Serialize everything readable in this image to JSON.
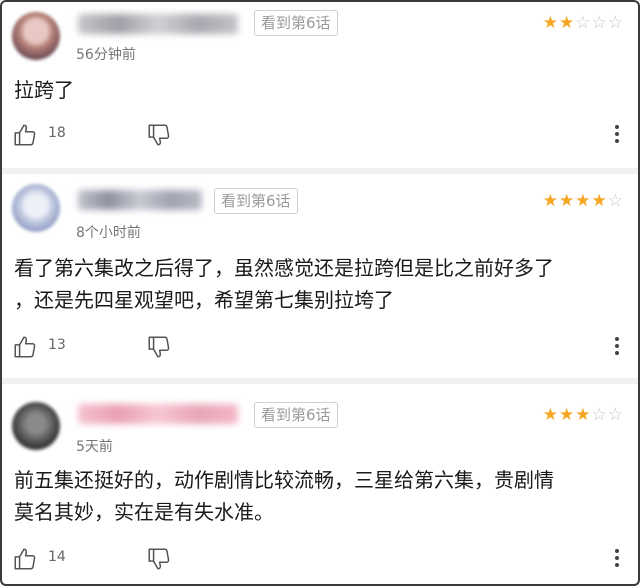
{
  "comments": [
    {
      "episode_badge": "看到第6话",
      "time": "56分钟前",
      "stars": "★★☆☆☆",
      "rating": 2,
      "lines": [
        "拉跨了"
      ],
      "likes": "18"
    },
    {
      "episode_badge": "看到第6话",
      "time": "8个小时前",
      "stars": "★★★★☆",
      "rating": 4,
      "lines": [
        "看了第六集改之后得了，虽然感觉还是拉跨但是比之前好多了",
        "，还是先四星观望吧，希望第七集别拉垮了"
      ],
      "likes": "13"
    },
    {
      "episode_badge": "看到第6话",
      "time": "5天前",
      "stars": "★★★☆☆",
      "rating": 3,
      "lines": [
        "前五集还挺好的，动作剧情比较流畅，三星给第六集，贵剧情",
        "莫名其妙，实在是有失水准。"
      ],
      "likes": "14"
    }
  ],
  "colors": {
    "star_active": "#f6a623",
    "star_inactive": "#c8c8c8",
    "name_blur_1": "#b9b9bd",
    "name_blur_2": "#a9acb6",
    "name_blur_3": "#f3b7c8"
  },
  "icons": [
    "thumbs-up-icon",
    "thumbs-down-icon",
    "more-vertical-icon"
  ]
}
